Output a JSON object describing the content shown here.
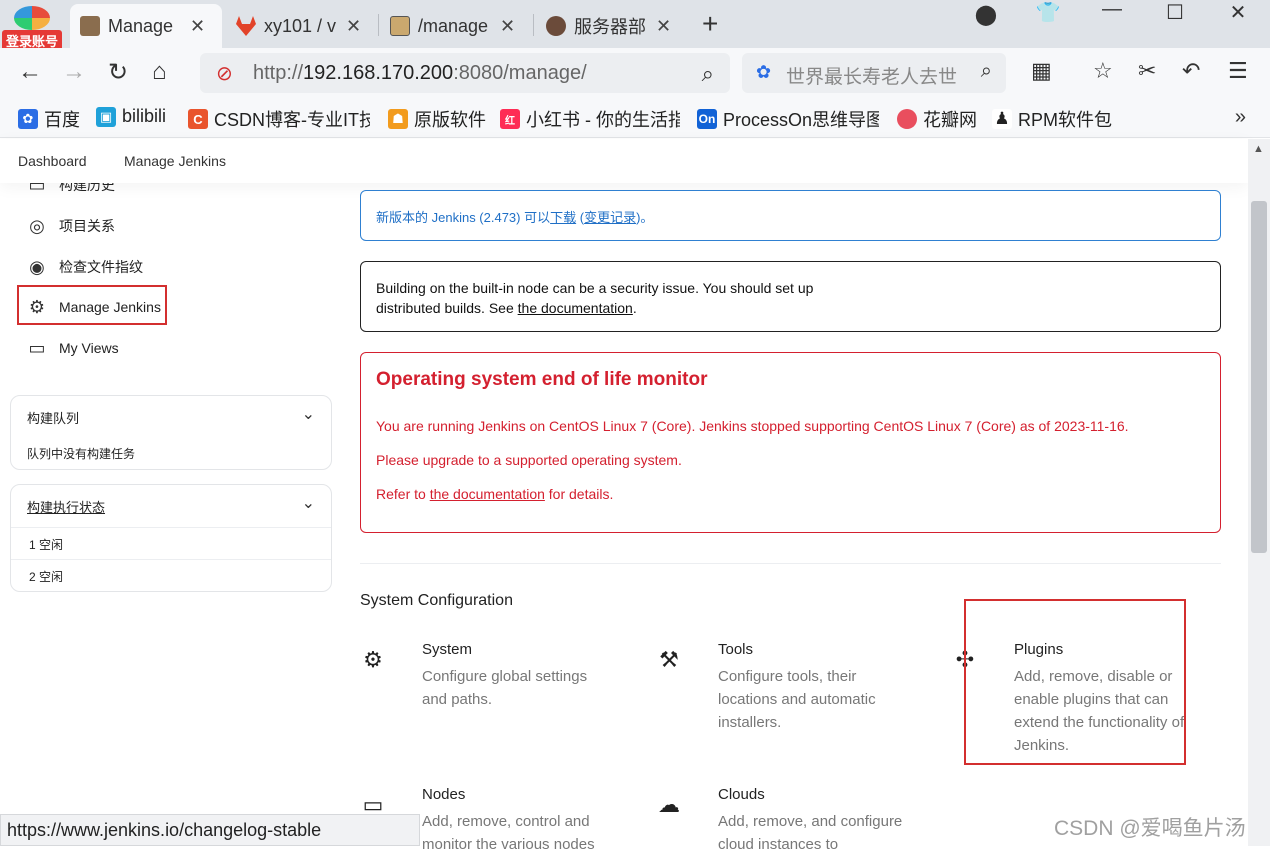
{
  "browser": {
    "login_badge": "登录账号",
    "tabs": [
      {
        "label": "Manage",
        "color": "#8a6d4e"
      },
      {
        "label": "xy101 / v",
        "color": "#e24329"
      },
      {
        "label": "/manage",
        "color": "#caa86e"
      },
      {
        "label": "服务器部",
        "color": "#6b4b3a"
      }
    ],
    "url_prefix": "http://",
    "url_host": "192.168.170.200",
    "url_rest": ":8080/manage/",
    "search_text": "世界最长寿老人去世",
    "bookmarks": [
      {
        "label": "百度",
        "icon": "paw-icon",
        "color": "#2b6de5",
        "glyph": "✿"
      },
      {
        "label": "bilibili",
        "icon": "tv-icon",
        "color": "#1fa1d9",
        "glyph": "▣"
      },
      {
        "label": "CSDN博客-专业IT技",
        "icon": "c-icon",
        "color": "#e9542d",
        "glyph": "C"
      },
      {
        "label": "原版软件",
        "icon": "figure-icon",
        "color": "#f29b1d",
        "glyph": "☗"
      },
      {
        "label": "小红书 - 你的生活指",
        "icon": "xhs-icon",
        "color": "#fe2c55",
        "glyph": "红"
      },
      {
        "label": "ProcessOn思维导图",
        "icon": "on-icon",
        "color": "#1162d6",
        "glyph": "On"
      },
      {
        "label": "花瓣网",
        "icon": "petal-icon",
        "color": "#e94e5e",
        "glyph": "●"
      },
      {
        "label": "RPM软件包",
        "icon": "penguin-icon",
        "color": "#333333",
        "glyph": "♟"
      }
    ]
  },
  "breadcrumb": [
    "Dashboard",
    "Manage Jenkins"
  ],
  "sidebar": {
    "items": [
      {
        "label": "构建历史",
        "icon": "history-icon"
      },
      {
        "label": "项目关系",
        "icon": "relationship-icon"
      },
      {
        "label": "检查文件指纹",
        "icon": "fingerprint-icon"
      },
      {
        "label": "Manage Jenkins",
        "icon": "gear-icon"
      },
      {
        "label": "My Views",
        "icon": "window-icon"
      }
    ],
    "queue": {
      "title": "构建队列",
      "empty": "队列中没有构建任务"
    },
    "executors": {
      "title": "构建执行状态",
      "rows": [
        "1  空闲",
        "2  空闲"
      ]
    }
  },
  "alerts": {
    "update": {
      "prefix": "新版本的 Jenkins (2.473) 可以",
      "download": "下载",
      "mid": " (",
      "changelog": "变更记录",
      "suffix": ")。"
    },
    "security": {
      "line1": "Building on the built-in node can be a security issue. You should set up",
      "line2_prefix": "distributed builds. See ",
      "link": "the documentation",
      "line2_suffix": "."
    },
    "eol": {
      "title": "Operating system end of life monitor",
      "line1": "You are running Jenkins on CentOS Linux 7 (Core). Jenkins stopped supporting CentOS Linux 7 (Core) as of 2023-11-16.",
      "line2": "Please upgrade to a supported operating system.",
      "line3_prefix": "Refer to ",
      "line3_link": "the documentation",
      "line3_suffix": " for details."
    }
  },
  "system_configuration": {
    "title": "System Configuration",
    "items": [
      {
        "title": "System",
        "desc": "Configure global settings and paths.",
        "icon": "gear-icon"
      },
      {
        "title": "Tools",
        "desc": "Configure tools, their locations and automatic installers.",
        "icon": "hammer-icon"
      },
      {
        "title": "Plugins",
        "desc": "Add, remove, disable or enable plugins that can extend the functionality of Jenkins.",
        "icon": "puzzle-icon"
      },
      {
        "title": "Nodes",
        "desc": "Add, remove, control and monitor the various nodes",
        "icon": "monitor-icon"
      },
      {
        "title": "Clouds",
        "desc": "Add, remove, and configure cloud instances to",
        "icon": "cloud-icon"
      }
    ]
  },
  "status_url": "https://www.jenkins.io/changelog-stable",
  "watermark": "CSDN @爱喝鱼片汤",
  "colors": {
    "highlight": "#d32f2f",
    "info": "#1f6fc6",
    "danger": "#d4202f"
  }
}
